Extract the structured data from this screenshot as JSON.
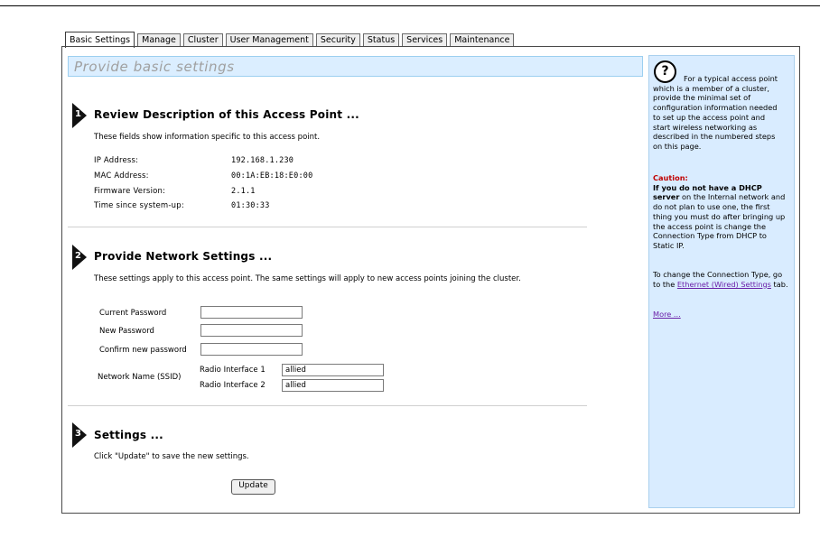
{
  "tabs": [
    {
      "label": "Basic Settings",
      "active": true
    },
    {
      "label": "Manage"
    },
    {
      "label": "Cluster"
    },
    {
      "label": "User Management"
    },
    {
      "label": "Security"
    },
    {
      "label": "Status"
    },
    {
      "label": "Services"
    },
    {
      "label": "Maintenance"
    }
  ],
  "header": {
    "title": "Provide basic settings"
  },
  "step1": {
    "num": "1",
    "title": "Review Description of this Access Point ...",
    "note": "These fields show information specific to this access point.",
    "fields": [
      {
        "label": "IP Address:",
        "value": "192.168.1.230"
      },
      {
        "label": "MAC Address:",
        "value": "00:1A:EB:18:E0:00"
      },
      {
        "label": "Firmware Version:",
        "value": "2.1.1"
      },
      {
        "label": "Time since system-up:",
        "value": "01:30:33"
      }
    ]
  },
  "step2": {
    "num": "2",
    "title": "Provide Network Settings ...",
    "note": "These settings apply to this access point. The same settings will apply to new access points joining the cluster.",
    "current_password_label": "Current Password",
    "new_password_label": "New Password",
    "confirm_password_label": "Confirm new password",
    "ssid_label": "Network Name (SSID)",
    "radio1_label": "Radio Interface 1",
    "radio1_value": "allied",
    "radio2_label": "Radio Interface 2",
    "radio2_value": "allied"
  },
  "step3": {
    "num": "3",
    "title": "Settings ...",
    "note": "Click \"Update\" to save the new settings.",
    "update_label": "Update"
  },
  "help": {
    "icon": "question-mark-icon",
    "intro": "For a typical access point which is a member of a cluster, provide the minimal set of configuration information needed to set up the access point and start wireless networking as described in the numbered steps on this page.",
    "caution_label": "Caution:",
    "caution_bold": "If you do not have a DHCP server",
    "caution_text": "on the Internal network and do not plan to use one, the first thing you must do after bringing up the access point is change the Connection Type from DHCP to Static IP.",
    "change_text_prefix": "To change the Connection Type, go to the",
    "change_link": "Ethernet (Wired) Settings",
    "change_text_suffix": "tab.",
    "more_link": "More ..."
  }
}
